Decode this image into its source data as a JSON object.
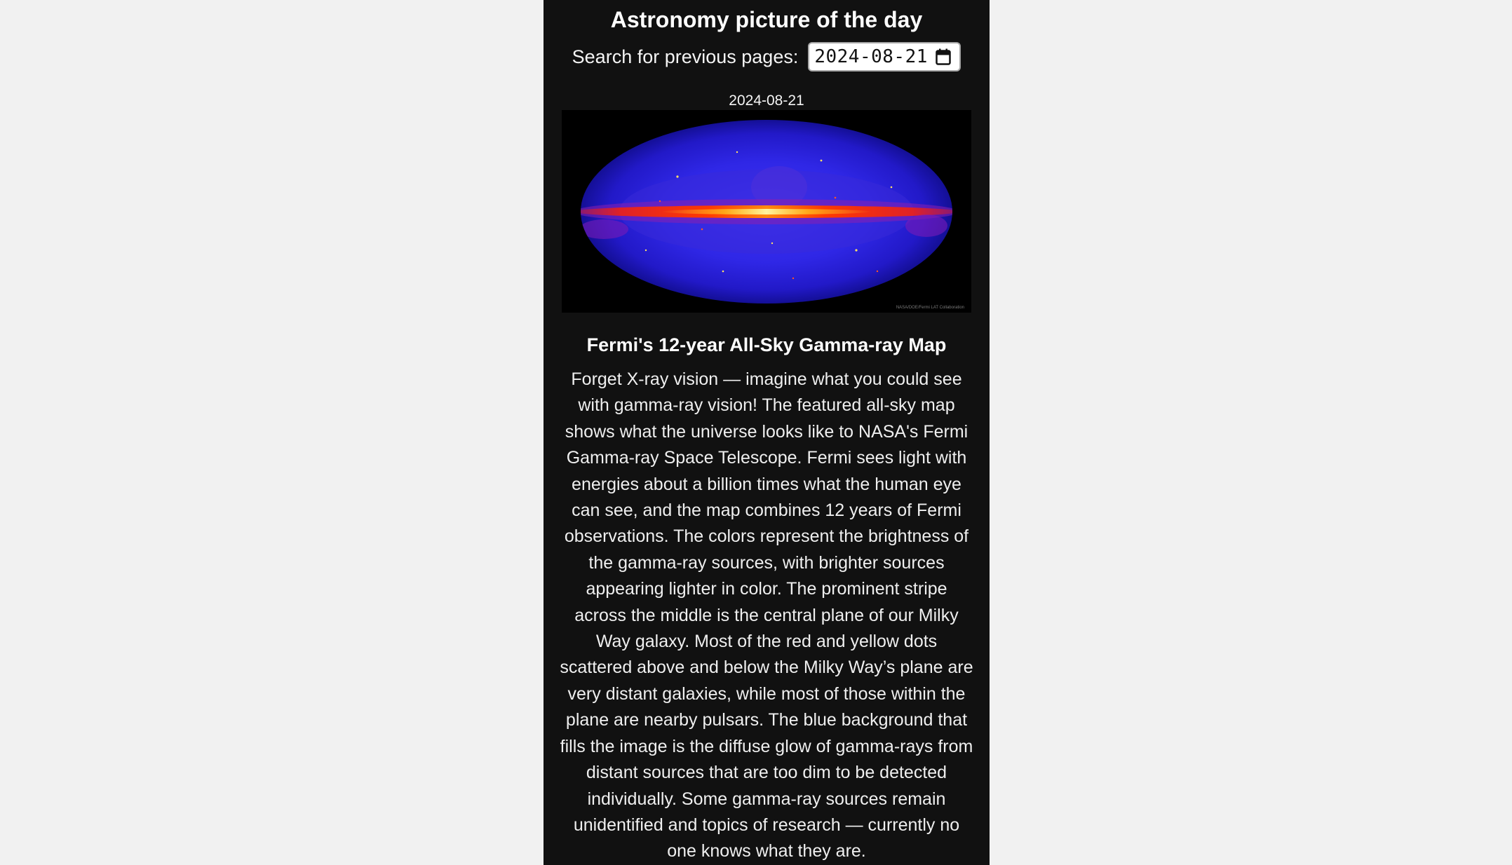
{
  "header": {
    "title": "Astronomy picture of the day"
  },
  "search": {
    "label": "Search for previous pages:",
    "date_value": "2024-08-21",
    "calendar_icon": "calendar-icon"
  },
  "picture": {
    "date": "2024-08-21",
    "credit": "NASA/DOE/Fermi LAT Collaboration",
    "title": "Fermi's 12-year All-Sky Gamma-ray Map",
    "explanation": "Forget X-ray vision — imagine what you could see with gamma-ray vision! The featured all-sky map shows what the universe looks like to NASA's Fermi Gamma-ray Space Telescope. Fermi sees light with energies about a billion times what the human eye can see, and the map combines 12 years of Fermi observations. The colors represent the brightness of the gamma-ray sources, with brighter sources appearing lighter in color. The prominent stripe across the middle is the central plane of our Milky Way galaxy. Most of the red and yellow dots scattered above and below the Milky Way’s plane are very distant galaxies, while most of those within the plane are nearby pulsars. The blue background that fills the image is the diffuse glow of gamma-rays from distant sources that are too dim to be detected individually. Some gamma-ray sources remain unidentified and topics of research — currently no one knows what they are."
  },
  "colors": {
    "page_background": "#f1f1f1",
    "panel_background": "#111111",
    "text": "#f4f4f4",
    "sky_blue": "#2a22e0",
    "plane_red": "#ff2200",
    "plane_yellow": "#ffee55"
  }
}
